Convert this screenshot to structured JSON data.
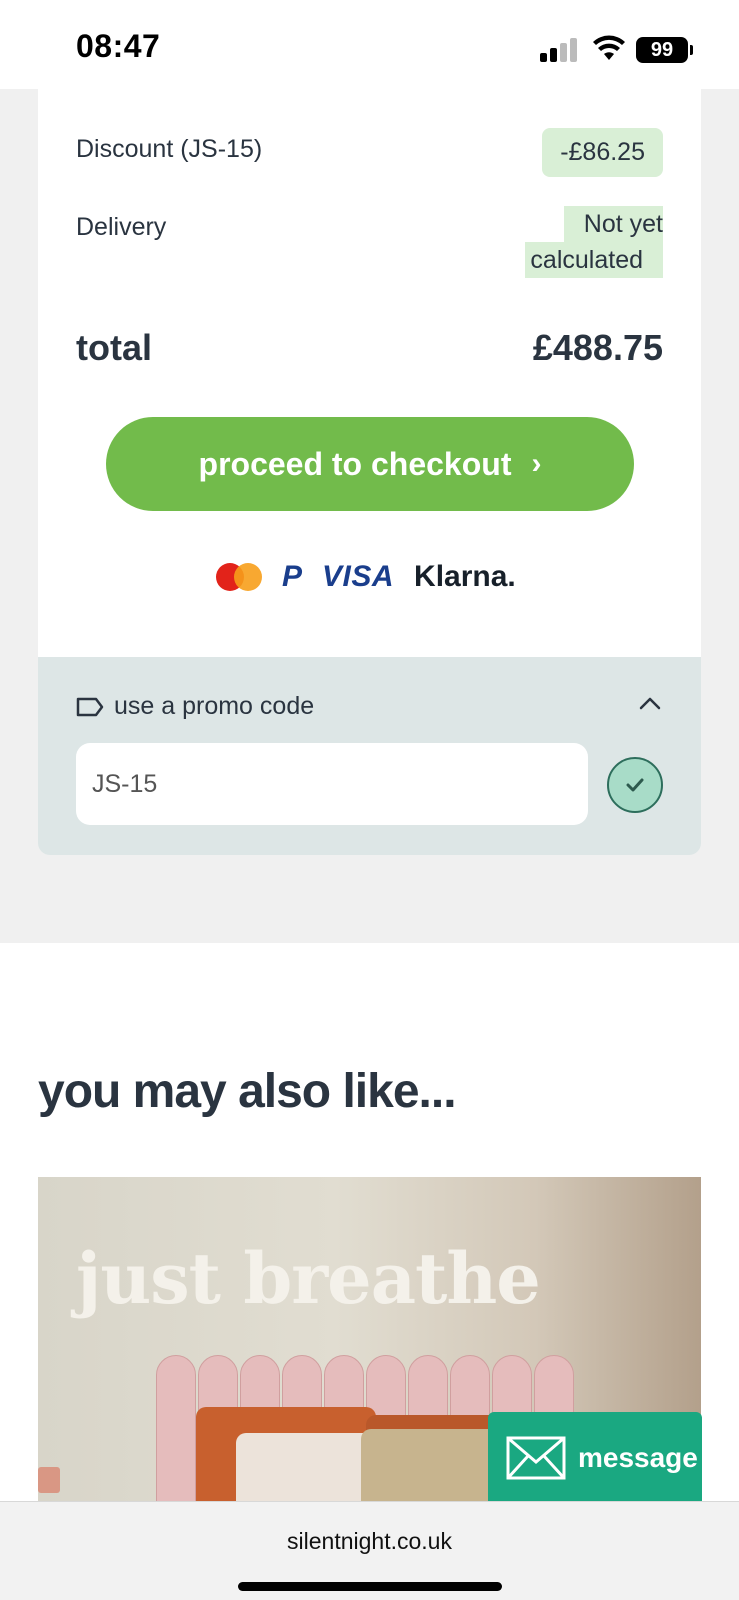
{
  "status_bar": {
    "time": "08:47",
    "battery": "99"
  },
  "summary": {
    "discount_label": "Discount (JS-15)",
    "discount_value": "-£86.25",
    "delivery_label": "Delivery",
    "delivery_value_line1": "Not yet",
    "delivery_value_line2": "calculated",
    "total_label": "total",
    "total_value": "£488.75",
    "checkout_label": "proceed to checkout",
    "checkout_chevron": "›"
  },
  "payment_methods": {
    "items": [
      "mastercard",
      "paypal",
      "visa",
      "klarna"
    ],
    "paypal_mark": "P",
    "visa_text": "VISA",
    "klarna_text": "Klarna."
  },
  "promo": {
    "label": "use a promo code",
    "code_value": "JS-15"
  },
  "recommendations": {
    "title": "you may also like...",
    "banner_text": "just breathe"
  },
  "chat": {
    "label": "message"
  },
  "browser": {
    "url": "silentnight.co.uk"
  },
  "colors": {
    "checkout_green": "#72bb4b",
    "highlight_green": "#d9efd6",
    "promo_bg": "#dde6e6",
    "message_teal": "#1aa881",
    "text_dark": "#2a3440"
  }
}
